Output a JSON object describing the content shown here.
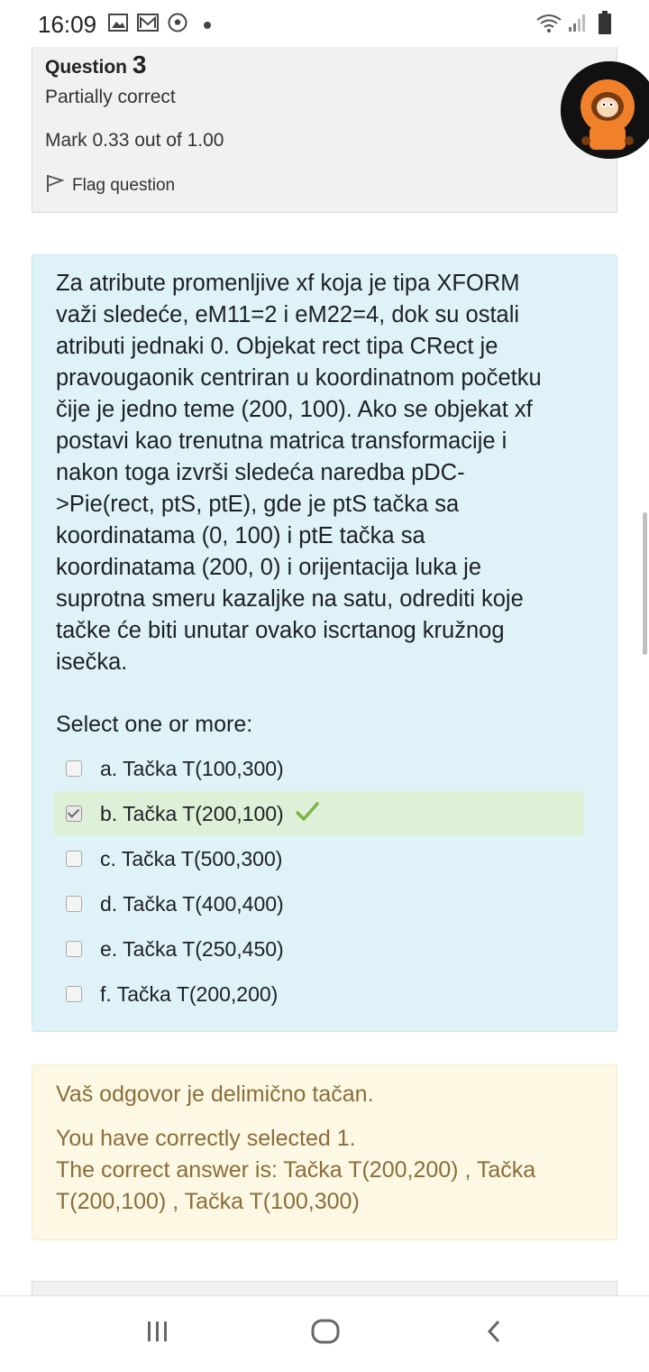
{
  "status_bar": {
    "time": "16:09",
    "left_icons": [
      "gallery-icon",
      "mail-icon",
      "soccer-ball-icon",
      "dot-icon"
    ],
    "right_icons": [
      "wifi-icon",
      "signal-icon",
      "battery-icon"
    ]
  },
  "question_info": {
    "label": "Question",
    "number": "3",
    "state": "Partially correct",
    "grade": "Mark 0.33 out of 1.00",
    "flag_label": "Flag question"
  },
  "question": {
    "text": "Za atribute promenljive xf koja je tipa XFORM važi sledeće, eM11=2 i eM22=4, dok su ostali atributi jednaki 0. Objekat rect tipa CRect je pravougaonik centriran u koordinatnom početku čije je jedno teme (200, 100). Ako se objekat xf postavi kao trenutna matrica transformacije i nakon toga izvrši sledeća naredba pDC->Pie(rect, ptS, ptE), gde je ptS tačka sa koordinatama (0, 100) i ptE tačka sa koordinatama (200, 0) i orijentacija luka je suprotna smeru kazaljke na satu, odrediti koje tačke će biti unutar ovako iscrtanog kružnog isečka.",
    "prompt": "Select one or more:",
    "answers": [
      {
        "label": "a. Tačka T(100,300)",
        "checked": false,
        "correct": false
      },
      {
        "label": "b. Tačka T(200,100)",
        "checked": true,
        "correct": true
      },
      {
        "label": "c. Tačka T(500,300)",
        "checked": false,
        "correct": false
      },
      {
        "label": "d. Tačka T(400,400)",
        "checked": false,
        "correct": false
      },
      {
        "label": "e. Tačka T(250,450)",
        "checked": false,
        "correct": false
      },
      {
        "label": "f. Tačka T(200,200)",
        "checked": false,
        "correct": false
      }
    ]
  },
  "feedback": {
    "partial": "Vaš odgovor je delimično tačan.",
    "selected": "You have correctly selected 1.",
    "correct_answer": "The correct answer is: Tačka T(200,200) , Tačka T(200,100) , Tačka T(100,300)"
  },
  "colors": {
    "question_bg": "#def2f8",
    "feedback_bg": "#fcf8e3",
    "feedback_text": "#8a6d3b",
    "correct_bg": "#dff0d8",
    "tick": "#7ab648"
  },
  "nav_bar": {
    "buttons": [
      "recent-apps-icon",
      "home-icon",
      "back-icon"
    ]
  }
}
